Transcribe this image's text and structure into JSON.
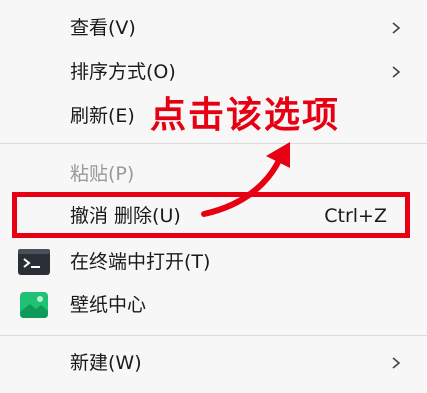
{
  "menu": {
    "items": [
      {
        "label": "查看(V)",
        "has_submenu": true
      },
      {
        "label": "排序方式(O)",
        "has_submenu": true
      },
      {
        "label": "刷新(E)"
      },
      {
        "label": "粘贴(P)",
        "disabled": true
      },
      {
        "label": "撤消 删除(U)",
        "shortcut": "Ctrl+Z"
      },
      {
        "label": "在终端中打开(T)",
        "icon": "terminal-icon"
      },
      {
        "label": "壁纸中心",
        "icon": "wallpaper-icon"
      },
      {
        "label": "新建(W)",
        "has_submenu": true
      }
    ]
  },
  "annotation": {
    "text": "点击该选项",
    "color": "#e60012"
  }
}
